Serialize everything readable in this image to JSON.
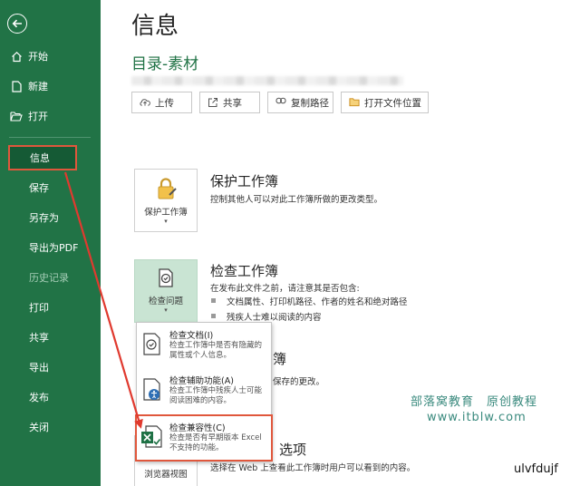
{
  "sidebar": {
    "items": [
      {
        "label": "开始"
      },
      {
        "label": "新建"
      },
      {
        "label": "打开"
      },
      {
        "label": "信息"
      },
      {
        "label": "保存"
      },
      {
        "label": "另存为"
      },
      {
        "label": "导出为PDF"
      },
      {
        "label": "历史记录"
      },
      {
        "label": "打印"
      },
      {
        "label": "共享"
      },
      {
        "label": "导出"
      },
      {
        "label": "发布"
      },
      {
        "label": "关闭"
      }
    ],
    "bg_color": "#217346",
    "highlight_color": "#e0573c"
  },
  "main": {
    "title": "信息",
    "doc_name": "目录-素材",
    "toolbar": {
      "upload": "上传",
      "share": "共享",
      "copy_path": "复制路径",
      "open_location": "打开文件位置"
    },
    "protect": {
      "button": "保护工作簿",
      "title": "保护工作簿",
      "desc": "控制其他人可以对此工作簿所做的更改类型。"
    },
    "inspect": {
      "button": "检查问题",
      "title": "检查工作簿",
      "desc": "在发布此文件之前，请注意其是否包含:",
      "bullets": [
        "文档属性、打印机路径、作者的姓名和绝对路径",
        "残疾人士难以阅读的内容"
      ]
    },
    "manage": {
      "title_fragment": "簿",
      "desc_fragment": "保存的更改。"
    },
    "browser": {
      "button": "浏览器视图",
      "title_fragment": "选项",
      "desc": "选择在 Web 上查看此工作簿时用户可以看到的内容。"
    }
  },
  "dropdown": {
    "items": [
      {
        "title": "检查文档(I)",
        "desc": "检查工作簿中是否有隐藏的属性或个人信息。"
      },
      {
        "title": "检查辅助功能(A)",
        "desc": "检查工作簿中残疾人士可能阅读困难的内容。"
      },
      {
        "title": "检查兼容性(C)",
        "desc": "检查是否有早期版本 Excel 不支持的功能。"
      }
    ]
  },
  "watermark": {
    "line1": "部落窝教育　原创教程",
    "line2": "www.itblw.com",
    "corner": "ulvfdujf"
  }
}
